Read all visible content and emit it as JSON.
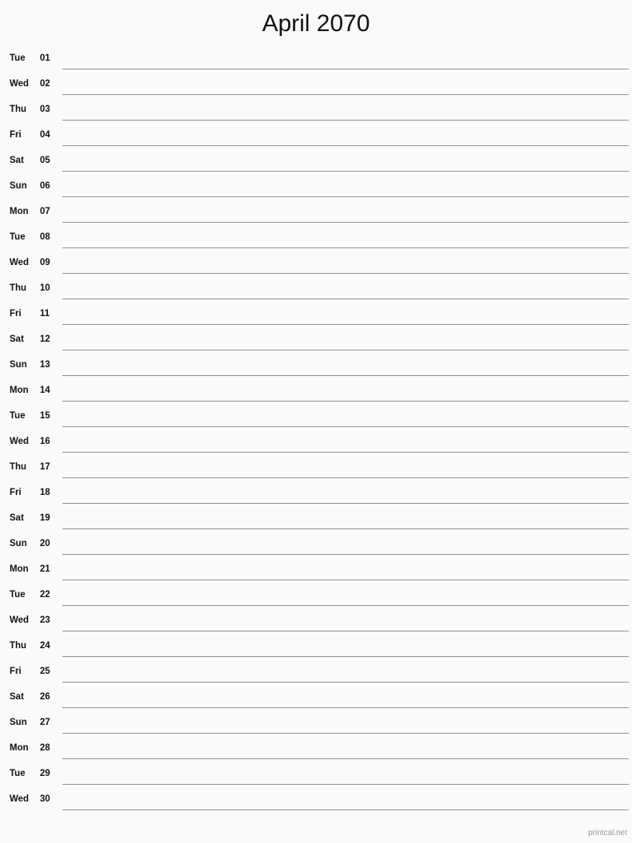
{
  "page": {
    "title": "April 2070",
    "background_color": "#fafaf8",
    "rule_color": "#909090",
    "text_color": "#111111"
  },
  "footer": {
    "label": "printcal.net",
    "color": "#9a9a9a"
  },
  "calendar": {
    "month": "April",
    "year": "2070",
    "rows": [
      {
        "weekday": "Tue",
        "date": "01"
      },
      {
        "weekday": "Wed",
        "date": "02"
      },
      {
        "weekday": "Thu",
        "date": "03"
      },
      {
        "weekday": "Fri",
        "date": "04"
      },
      {
        "weekday": "Sat",
        "date": "05"
      },
      {
        "weekday": "Sun",
        "date": "06"
      },
      {
        "weekday": "Mon",
        "date": "07"
      },
      {
        "weekday": "Tue",
        "date": "08"
      },
      {
        "weekday": "Wed",
        "date": "09"
      },
      {
        "weekday": "Thu",
        "date": "10"
      },
      {
        "weekday": "Fri",
        "date": "11"
      },
      {
        "weekday": "Sat",
        "date": "12"
      },
      {
        "weekday": "Sun",
        "date": "13"
      },
      {
        "weekday": "Mon",
        "date": "14"
      },
      {
        "weekday": "Tue",
        "date": "15"
      },
      {
        "weekday": "Wed",
        "date": "16"
      },
      {
        "weekday": "Thu",
        "date": "17"
      },
      {
        "weekday": "Fri",
        "date": "18"
      },
      {
        "weekday": "Sat",
        "date": "19"
      },
      {
        "weekday": "Sun",
        "date": "20"
      },
      {
        "weekday": "Mon",
        "date": "21"
      },
      {
        "weekday": "Tue",
        "date": "22"
      },
      {
        "weekday": "Wed",
        "date": "23"
      },
      {
        "weekday": "Thu",
        "date": "24"
      },
      {
        "weekday": "Fri",
        "date": "25"
      },
      {
        "weekday": "Sat",
        "date": "26"
      },
      {
        "weekday": "Sun",
        "date": "27"
      },
      {
        "weekday": "Mon",
        "date": "28"
      },
      {
        "weekday": "Tue",
        "date": "29"
      },
      {
        "weekday": "Wed",
        "date": "30"
      }
    ]
  }
}
